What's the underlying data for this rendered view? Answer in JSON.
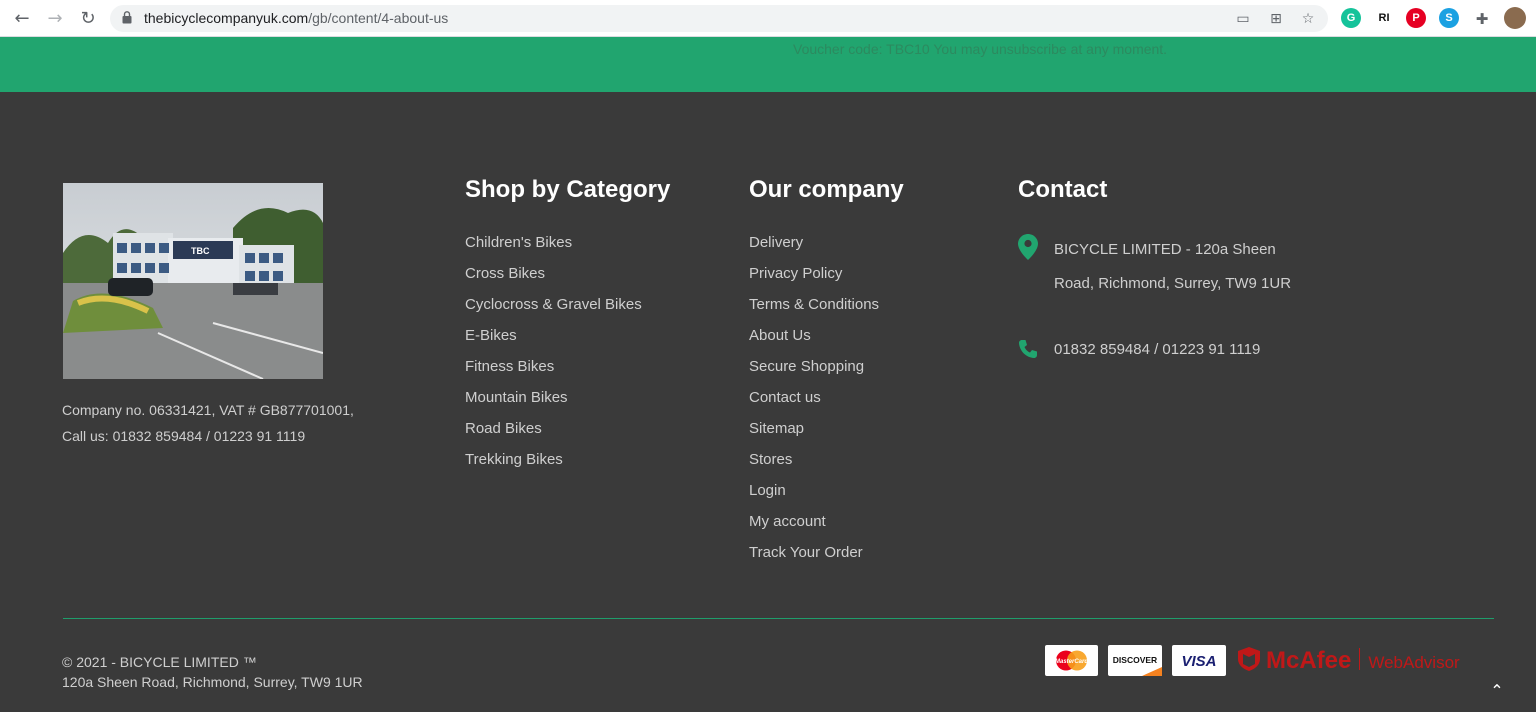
{
  "browser": {
    "url_domain": "thebicyclecompanyuk.com",
    "url_path": "/gb/content/4-about-us",
    "extensions": [
      "G",
      "RI",
      "P",
      "S"
    ]
  },
  "banner": {
    "voucher_text": "Voucher code: TBC10 You may unsubscribe at any moment."
  },
  "company": {
    "info_line1": "Company no. 06331421, VAT # GB877701001,",
    "info_line2": "Call us: 01832 859484 / 01223 91 1119",
    "photo_sign": "TBC"
  },
  "shop_by_category": {
    "title": "Shop by Category",
    "items": [
      "Children's Bikes",
      "Cross Bikes",
      "Cyclocross & Gravel Bikes",
      "E-Bikes",
      "Fitness Bikes",
      "Mountain Bikes",
      "Road Bikes",
      "Trekking Bikes"
    ]
  },
  "our_company": {
    "title": "Our company",
    "items": [
      "Delivery",
      "Privacy Policy",
      "Terms & Conditions",
      "About Us",
      "Secure Shopping",
      "Contact us",
      "Sitemap",
      "Stores",
      "Login",
      "My account",
      "Track Your Order"
    ]
  },
  "contact": {
    "title": "Contact",
    "address": "BICYCLE LIMITED - 120a Sheen Road, Richmond, Surrey, TW9 1UR",
    "phone": "01832 859484 / 01223 91 1119"
  },
  "bottom": {
    "copyright": "© 2021 - BICYCLE LIMITED ™",
    "address": "120a Sheen Road, Richmond, Surrey, TW9 1UR"
  },
  "payments": {
    "mastercard": "MasterCard",
    "discover": "DISCOVER",
    "visa": "VISA",
    "mcafee_brand": "McAfee",
    "mcafee_product": "WebAdvisor"
  },
  "colors": {
    "accent_green": "#21a56f",
    "footer_bg": "#3a3a3a",
    "mcafee_red": "#c01818"
  }
}
